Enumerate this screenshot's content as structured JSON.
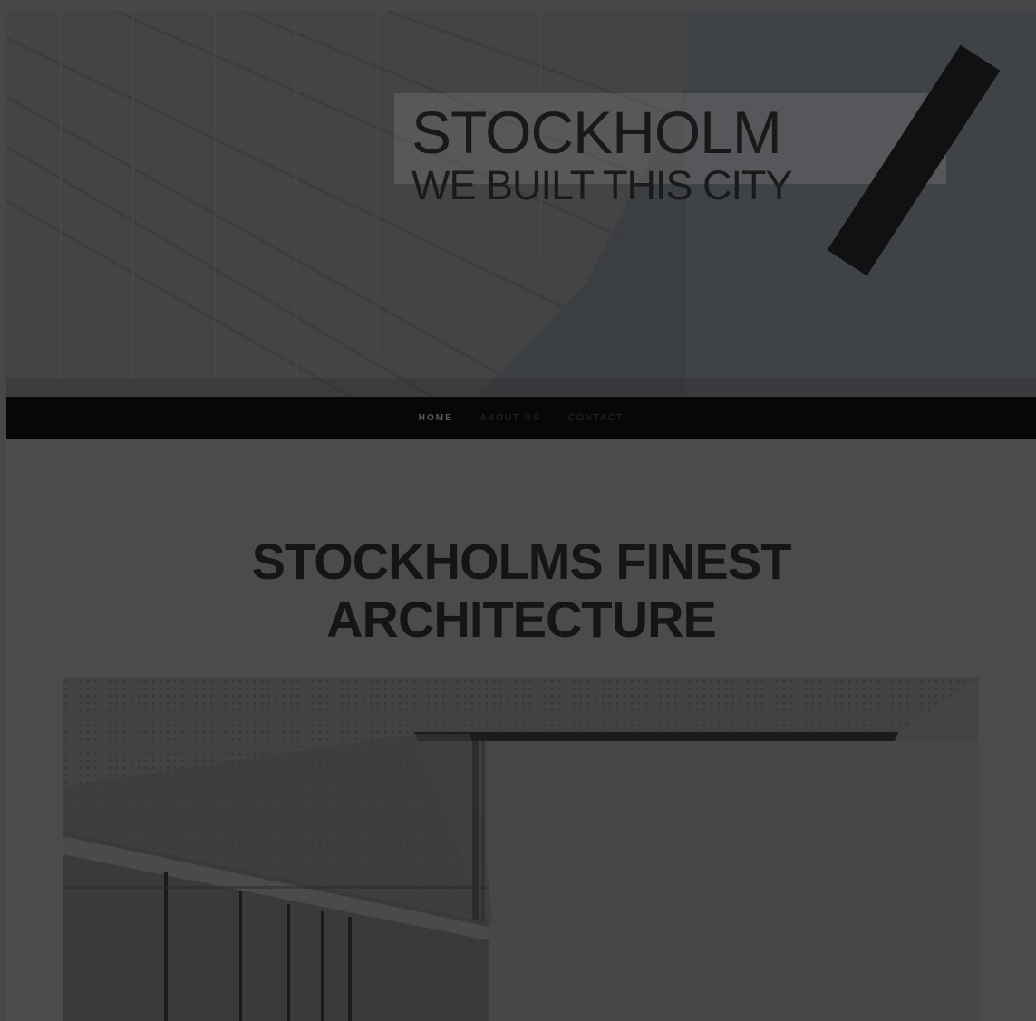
{
  "hero": {
    "title": "STOCKHOLM",
    "subtitle": "WE BUILT THIS CITY"
  },
  "nav": {
    "items": [
      {
        "label": "HOME",
        "active": true
      },
      {
        "label": "ABOUT US",
        "active": false
      },
      {
        "label": "CONTACT",
        "active": false
      }
    ]
  },
  "main": {
    "heading_line1": "STOCKHOLMS FINEST",
    "heading_line2": "ARCHITECTURE"
  },
  "colors": {
    "overlay": "#474747",
    "navbar": "#070707",
    "sky": "#3a3d41",
    "heading_text": "#151515"
  }
}
